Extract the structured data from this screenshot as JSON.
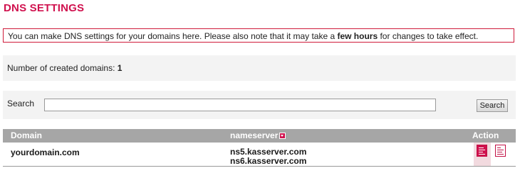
{
  "page": {
    "title": "DNS SETTINGS"
  },
  "notice": {
    "text_before": "You can make DNS settings for your domains here. Please also note that it may take a ",
    "bold": "few hours",
    "text_after": " for changes to take effect."
  },
  "stats": {
    "label": "Number of created domains: ",
    "count": "1"
  },
  "search": {
    "label": "Search",
    "value": "",
    "button_label": "Search"
  },
  "table": {
    "headers": {
      "domain": "Domain",
      "nameserver": "nameserver",
      "action": "Action"
    },
    "rows": [
      {
        "domain": "yourdomain.com",
        "ns1": "ns5.kasserver.com",
        "ns2": "ns6.kasserver.com"
      }
    ]
  },
  "colors": {
    "accent": "#d0114e",
    "header_bg": "#a6a6a6",
    "panel_bg": "#f3f3f3"
  },
  "icons": {
    "sort": "sort-down-icon",
    "edit": "edit-dns-icon",
    "info": "dns-info-icon"
  }
}
